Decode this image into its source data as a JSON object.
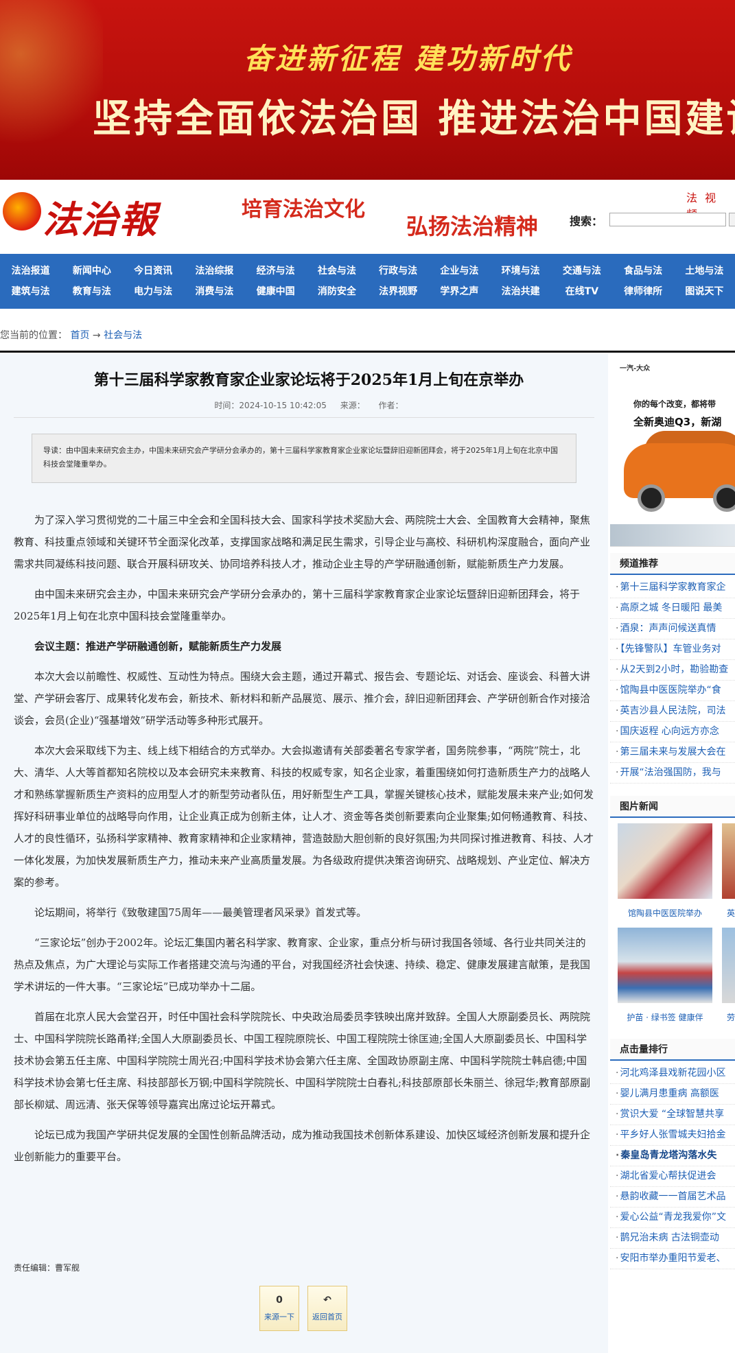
{
  "banner": {
    "line1": "奋进新征程  建功新时代",
    "line2": "坚持全面依法治国  推进法治中国建设"
  },
  "header": {
    "logo_text": "法治報道",
    "slogan1": "培育法治文化",
    "slogan2": "弘扬法治精神",
    "top_links": "法 视 频",
    "search_label": "搜索："
  },
  "nav": {
    "row1": [
      "法治报道",
      "新闻中心",
      "今日资讯",
      "法治综报",
      "经济与法",
      "社会与法",
      "行政与法",
      "企业与法",
      "环境与法",
      "交通与法",
      "食品与法",
      "土地与法"
    ],
    "row2": [
      "建筑与法",
      "教育与法",
      "电力与法",
      "消费与法",
      "健康中国",
      "消防安全",
      "法界视野",
      "学界之声",
      "法治共建",
      "在线TV",
      "律师律所",
      "图说天下"
    ]
  },
  "breadcrumb": {
    "prefix": "您当前的位置：",
    "home": "首页",
    "sep": "→",
    "current": "社会与法"
  },
  "article": {
    "title": "第十三届科学家教育家企业家论坛将于2025年1月上旬在京举办",
    "time_label": "时间：2024-10-15 10:42:05",
    "source_label": "来源：",
    "author_label": "作者：",
    "summary": "导读：由中国未来研究会主办，中国未来研究会产学研分会承办的，第十三届科学家教育家企业家论坛暨辞旧迎新团拜会，将于2025年1月上旬在北京中国科技会堂隆重举办。",
    "p1": "为了深入学习贯彻党的二十届三中全会和全国科技大会、国家科学技术奖励大会、两院院士大会、全国教育大会精神，聚焦教育、科技重点领域和关键环节全面深化改革，支撑国家战略和满足民生需求，引导企业与高校、科研机构深度融合，面向产业需求共同凝练科技问题、联合开展科研攻关、协同培养科技人才，推动企业主导的产学研融通创新，赋能新质生产力发展。",
    "p2": "由中国未来研究会主办，中国未来研究会产学研分会承办的，第十三届科学家教育家企业家论坛暨辞旧迎新团拜会，将于2025年1月上旬在北京中国科技会堂隆重举办。",
    "p3": "会议主题：推进产学研融通创新，赋能新质生产力发展",
    "p4": "本次大会以前瞻性、权威性、互动性为特点。围绕大会主题，通过开幕式、报告会、专题论坛、对话会、座谈会、科普大讲堂、产学研会客厅、成果转化发布会，新技术、新材料和新产品展览、展示、推介会，辞旧迎新团拜会、产学研创新合作对接洽谈会，会员(企业)“强基增效”研学活动等多种形式展开。",
    "p5": "本次大会采取线下为主、线上线下相结合的方式举办。大会拟邀请有关部委著名专家学者，国务院参事，“两院”院士，北大、清华、人大等首都知名院校以及本会研究未来教育、科技的权威专家，知名企业家，着重围绕如何打造新质生产力的战略人才和熟练掌握新质生产资料的应用型人才的新型劳动者队伍，用好新型生产工具，掌握关键核心技术，赋能发展未来产业;如何发挥好科研事业单位的战略导向作用，让企业真正成为创新主体，让人才、资金等各类创新要素向企业聚集;如何畅通教育、科技、人才的良性循环，弘扬科学家精神、教育家精神和企业家精神，营造鼓励大胆创新的良好氛围;为共同探讨推进教育、科技、人才一体化发展，为加快发展新质生产力，推动未来产业高质量发展。为各级政府提供决策咨询研究、战略规划、产业定位、解决方案的参考。",
    "p6": "论坛期间，将举行《致敬建国75周年——最美管理者风采录》首发式等。",
    "p7": "“三家论坛”创办于2002年。论坛汇集国内著名科学家、教育家、企业家，重点分析与研讨我国各领域、各行业共同关注的热点及焦点，为广大理论与实际工作者搭建交流与沟通的平台，对我国经济社会快速、持续、稳定、健康发展建言献策，是我国学术讲坛的一件大事。“三家论坛”已成功举办十二届。",
    "p8": "首届在北京人民大会堂召开，时任中国社会科学院院长、中央政治局委员李铁映出席并致辞。全国人大原副委员长、两院院士、中国科学院院长路甬祥;全国人大原副委员长、中国工程院原院长、中国工程院院士徐匡迪;全国人大原副委员长、中国科学技术协会第五任主席、中国科学院院士周光召;中国科学技术协会第六任主席、全国政协原副主席、中国科学院院士韩启德;中国科学技术协会第七任主席、科技部部长万钢;中国科学院院长、中国科学院院士白春礼;科技部原部长朱丽兰、徐冠华;教育部原副部长柳斌、周远清、张天保等领导嘉宾出席过论坛开幕式。",
    "p9": "论坛已成为我国产学研共促发展的全国性创新品牌活动，成为推动我国技术创新体系建设、加快区域经济创新发展和提升企业创新能力的重要平台。",
    "editor": "责任编辑：曹军舰",
    "prev_icon": "0",
    "prev_label": "来源一下",
    "home_icon": "↶",
    "home_label": "返回首页"
  },
  "sidebar": {
    "ad": {
      "brand": "一汽-大众",
      "text1": "你的每个改变，都将带",
      "text2": "全新奥迪Q3，新湖"
    },
    "channel_title": "频道推荐",
    "channel_items": [
      "第十三届科学家教育家企",
      "高原之城 冬日暖阳 最美",
      "酒泉：声声问候送真情",
      "【先锋警队】车管业务对",
      "从2天到2小时，勘验勘查",
      "馆陶县中医医院举办“食",
      "英吉沙县人民法院，司法",
      "国庆返程 心向远方亦念",
      "第三届未来与发展大会在",
      "开展“法治强国防，我与"
    ],
    "pic_title": "图片新闻",
    "pics": [
      {
        "caption": "馆陶县中医医院举办"
      },
      {
        "caption": "英"
      },
      {
        "caption": "护苗 · 绿书签 健康伴"
      },
      {
        "caption": "劳"
      }
    ],
    "rank_title": "点击量排行",
    "rank_items": [
      "河北鸡泽县戏新花园小区",
      "婴儿满月患重病 高额医",
      "赏识大爱 “全球智慧共享",
      "平乡好人张雪城夫妇拾金",
      "秦皇岛青龙塔沟落水失",
      "湖北省爱心帮扶促进会",
      "悬韵收藏一一首届艺术品",
      "爱心公益“青龙我爱你”文",
      "鹊兄治未病 古法铜壶动",
      "安阳市举办重阳节爱老、"
    ]
  }
}
